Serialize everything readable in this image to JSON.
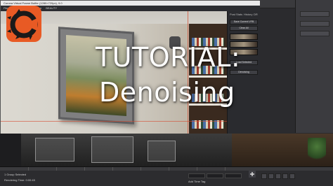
{
  "overlay": {
    "title_line1": "TUTORIAL:",
    "title_line2": "Denoising"
  },
  "vfb": {
    "window_title": "Corona Virtual Frame Buffer (1280×720px), 9.0",
    "menu": [
      "File",
      "View",
      "Tabs",
      "Region",
      "BEAUTY"
    ],
    "side_tabs": [
      "Post",
      "Stats",
      "History",
      "DR"
    ],
    "side_buttons": [
      "Save Current VFB",
      "Clear All",
      "Load Selected",
      "Denoising"
    ]
  },
  "max_panel": {
    "buttons": [
      "Render",
      "Settings",
      "Save All"
    ]
  },
  "statusbar": {
    "selection": "1 Group Selected",
    "prompt": "Rendering Time: 0:00:45",
    "add_time_tag": "Add Time Tag"
  },
  "colors": {
    "logo_bg": "#e85a24",
    "accent": "#d64a2e"
  },
  "icons": [
    "corona-logo-icon",
    "play-icon"
  ]
}
